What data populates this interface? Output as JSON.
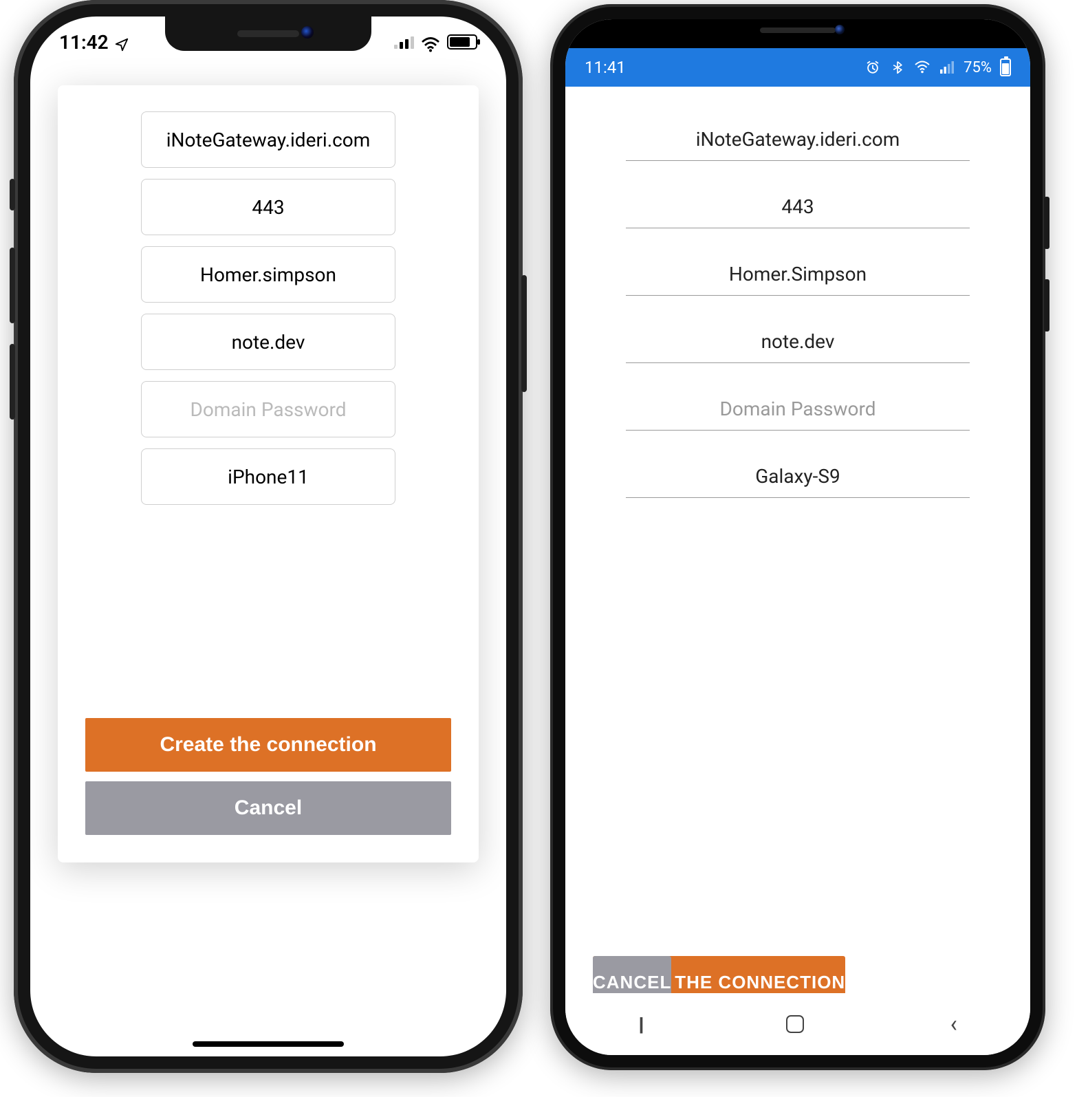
{
  "colors": {
    "primary": "#dd7126",
    "secondary": "#9a9aa2",
    "android_status": "#1f7ae0"
  },
  "iphone": {
    "status": {
      "time": "11:42",
      "battery_pct": 72
    },
    "fields": {
      "gateway": "iNoteGateway.ideri.com",
      "port": "443",
      "user": "Homer.simpson",
      "domain": "note.dev",
      "password_placeholder": "Domain Password",
      "device": "iPhone11"
    },
    "buttons": {
      "create": "Create the connection",
      "cancel": "Cancel"
    }
  },
  "android": {
    "status": {
      "time": "11:41",
      "battery_label": "75%"
    },
    "fields": {
      "gateway": "iNoteGateway.ideri.com",
      "port": "443",
      "user": "Homer.Simpson",
      "domain": "note.dev",
      "password_placeholder": "Domain Password",
      "device": "Galaxy-S9"
    },
    "buttons": {
      "create": "CREATE THE CONNECTION",
      "cancel": "CANCEL"
    }
  }
}
